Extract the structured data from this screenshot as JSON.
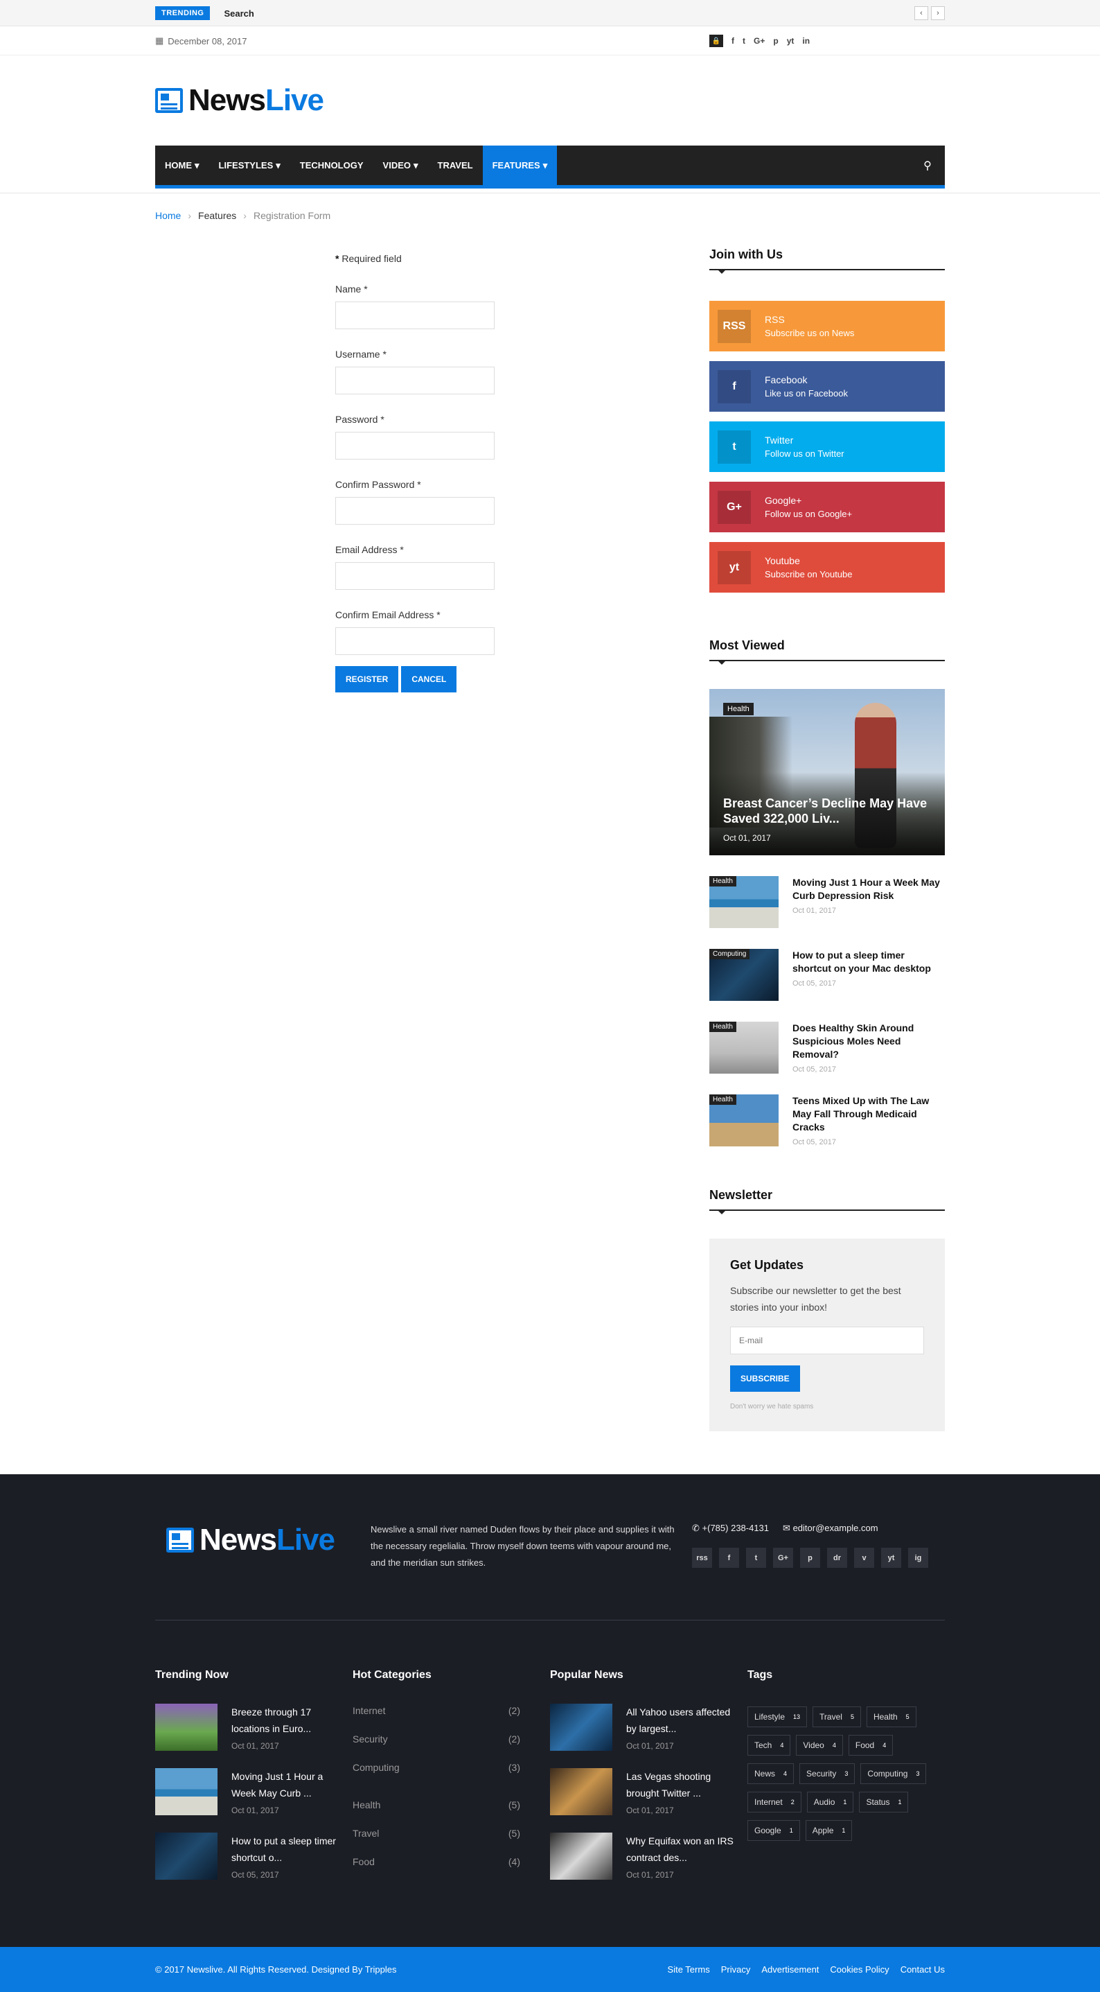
{
  "topbar": {
    "trending_label": "TRENDING",
    "trending_text": "Search",
    "date": "December 08, 2017",
    "social": [
      "f",
      "t",
      "G+",
      "p",
      "yt",
      "in"
    ]
  },
  "brand": {
    "name_dark": "News",
    "name_accent": "Live"
  },
  "nav": {
    "items": [
      {
        "label": "HOME",
        "caret": "▾"
      },
      {
        "label": "LIFESTYLES",
        "caret": "▾"
      },
      {
        "label": "TECHNOLOGY",
        "caret": ""
      },
      {
        "label": "VIDEO",
        "caret": "▾"
      },
      {
        "label": "TRAVEL",
        "caret": ""
      },
      {
        "label": "FEATURES",
        "caret": "▾"
      }
    ]
  },
  "breadcrumb": {
    "home": "Home",
    "mid": "Features",
    "current": "Registration Form"
  },
  "form": {
    "required_note": "Required field",
    "required_star": "*",
    "fields": [
      {
        "label": "Name *"
      },
      {
        "label": "Username *"
      },
      {
        "label": "Password *"
      },
      {
        "label": "Confirm Password *"
      },
      {
        "label": "Email Address *"
      },
      {
        "label": "Confirm Email Address *"
      }
    ],
    "register_label": "REGISTER",
    "cancel_label": "CANCEL"
  },
  "sidebar": {
    "join_title": "Join with Us",
    "socials": [
      {
        "name": "RSS",
        "sub": "Subscribe us on News",
        "color": "#f7993a",
        "icon": "RSS"
      },
      {
        "name": "Facebook",
        "sub": "Like us on Facebook",
        "color": "#3b5a9a",
        "icon": "f"
      },
      {
        "name": "Twitter",
        "sub": "Follow us on Twitter",
        "color": "#03aced",
        "icon": "t"
      },
      {
        "name": "Google+",
        "sub": "Follow us on Google+",
        "color": "#c53743",
        "icon": "G+"
      },
      {
        "name": "Youtube",
        "sub": "Subscribe on Youtube",
        "color": "#e04c3c",
        "icon": "yt"
      }
    ],
    "most_viewed_title": "Most Viewed",
    "feature": {
      "category": "Health",
      "title": "Breast Cancer’s Decline May Have Saved 322,000 Liv...",
      "date": "Oct 01, 2017"
    },
    "items": [
      {
        "category": "Health",
        "title": "Moving Just 1 Hour a Week May Curb Depression Risk",
        "date": "Oct 01, 2017"
      },
      {
        "category": "Computing",
        "title": "How to put a sleep timer shortcut on your Mac desktop",
        "date": "Oct 05, 2017"
      },
      {
        "category": "Health",
        "title": "Does Healthy Skin Around Suspicious Moles Need Removal?",
        "date": "Oct 05, 2017"
      },
      {
        "category": "Health",
        "title": "Teens Mixed Up with The Law May Fall Through Medicaid Cracks",
        "date": "Oct 05, 2017"
      }
    ],
    "newsletter_title": "Newsletter",
    "nl_heading": "Get Updates",
    "nl_text": "Subscribe our newsletter to get the best stories into your inbox!",
    "nl_placeholder": "E-mail",
    "nl_button": "SUBSCRIBE",
    "nl_note": "Don't worry we hate spams"
  },
  "footer": {
    "about": "Newslive a small river named Duden flows by their place and supplies it with the necessary regelialia. Throw myself down teems with vapour around me, and the meridian sun strikes.",
    "phone": "+(785) 238-4131",
    "email": "editor@example.com",
    "social": [
      "rss",
      "f",
      "t",
      "G+",
      "p",
      "dr",
      "v",
      "yt",
      "ig"
    ],
    "trending_title": "Trending Now",
    "trending": [
      {
        "title": "Breeze through 17 locations in Euro...",
        "date": "Oct 01, 2017"
      },
      {
        "title": "Moving Just 1 Hour a Week May Curb ...",
        "date": "Oct 01, 2017"
      },
      {
        "title": "How to put a sleep timer shortcut o...",
        "date": "Oct 05, 2017"
      }
    ],
    "categories_title": "Hot Categories",
    "categories": [
      {
        "name": "Internet",
        "count": "(2)"
      },
      {
        "name": "Security",
        "count": "(2)"
      },
      {
        "name": "Computing",
        "count": "(3)"
      },
      {
        "name": "Health",
        "count": "(5)"
      },
      {
        "name": "Travel",
        "count": "(5)"
      },
      {
        "name": "Food",
        "count": "(4)"
      }
    ],
    "popular_title": "Popular News",
    "popular": [
      {
        "title": "All Yahoo users affected by largest...",
        "date": "Oct 01, 2017"
      },
      {
        "title": "Las Vegas shooting brought Twitter ...",
        "date": "Oct 01, 2017"
      },
      {
        "title": "Why Equifax won an IRS contract des...",
        "date": "Oct 01, 2017"
      }
    ],
    "tags_title": "Tags",
    "tags": [
      {
        "name": "Lifestyle",
        "count": "13"
      },
      {
        "name": "Travel",
        "count": "5"
      },
      {
        "name": "Health",
        "count": "5"
      },
      {
        "name": "Tech",
        "count": "4"
      },
      {
        "name": "Video",
        "count": "4"
      },
      {
        "name": "Food",
        "count": "4"
      },
      {
        "name": "News",
        "count": "4"
      },
      {
        "name": "Security",
        "count": "3"
      },
      {
        "name": "Computing",
        "count": "3"
      },
      {
        "name": "Internet",
        "count": "2"
      },
      {
        "name": "Audio",
        "count": "1"
      },
      {
        "name": "Status",
        "count": "1"
      },
      {
        "name": "Google",
        "count": "1"
      },
      {
        "name": "Apple",
        "count": "1"
      }
    ]
  },
  "bottom": {
    "copyright": "© 2017 Newslive. All Rights Reserved. Designed By Tripples",
    "links": [
      "Site Terms",
      "Privacy",
      "Advertisement",
      "Cookies Policy",
      "Contact Us"
    ]
  }
}
